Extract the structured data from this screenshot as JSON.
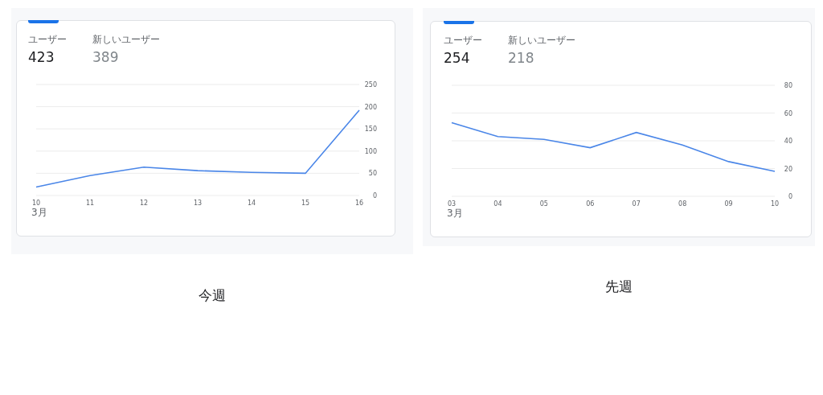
{
  "panels": [
    {
      "caption": "今週",
      "metrics": [
        {
          "label": "ユーザー",
          "value": "423",
          "selected": true
        },
        {
          "label": "新しいユーザー",
          "value": "389",
          "selected": false
        }
      ],
      "month": "3月",
      "chart_data": {
        "type": "line",
        "categories": [
          "10",
          "11",
          "12",
          "13",
          "14",
          "15",
          "16"
        ],
        "series": [
          {
            "color": "#4a86e8",
            "values": [
              19,
              45,
              64,
              56,
              52,
              50,
              192
            ]
          }
        ],
        "ylim": [
          0,
          250
        ],
        "grid": true,
        "yticks": [
          0,
          50,
          100,
          150,
          200,
          250
        ]
      }
    },
    {
      "caption": "先週",
      "metrics": [
        {
          "label": "ユーザー",
          "value": "254",
          "selected": true
        },
        {
          "label": "新しいユーザー",
          "value": "218",
          "selected": false
        }
      ],
      "month": "3月",
      "chart_data": {
        "type": "line",
        "categories": [
          "03",
          "04",
          "05",
          "06",
          "07",
          "08",
          "09",
          "10"
        ],
        "series": [
          {
            "color": "#4a86e8",
            "values": [
              53,
              43,
              41,
              35,
              46,
              37,
              25,
              18
            ]
          }
        ],
        "ylim": [
          0,
          80
        ],
        "grid": true,
        "yticks": [
          0,
          20,
          40,
          60,
          80
        ]
      }
    }
  ]
}
